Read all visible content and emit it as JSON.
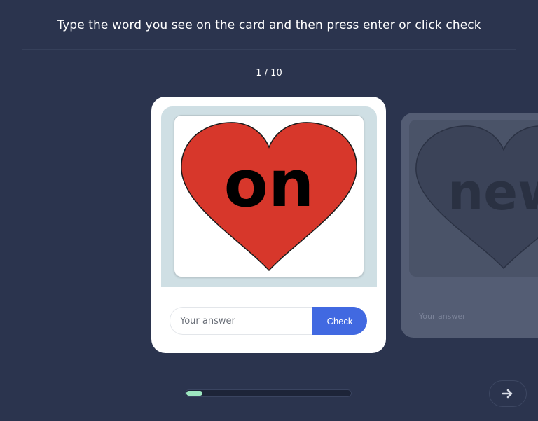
{
  "instruction": "Type the word you see on the card and then press enter or click check",
  "counter": "1 / 10",
  "current_card": {
    "word": "on",
    "heart_color": "#d7372b",
    "frame_color": "#cfdfe4"
  },
  "answer": {
    "placeholder": "Your answer",
    "value": "",
    "check_label": "Check"
  },
  "next_card": {
    "word": "new",
    "placeholder": "Your answer"
  },
  "progress": {
    "current": 1,
    "total": 10
  },
  "navigation": {
    "next_icon": "arrow-right-icon"
  }
}
